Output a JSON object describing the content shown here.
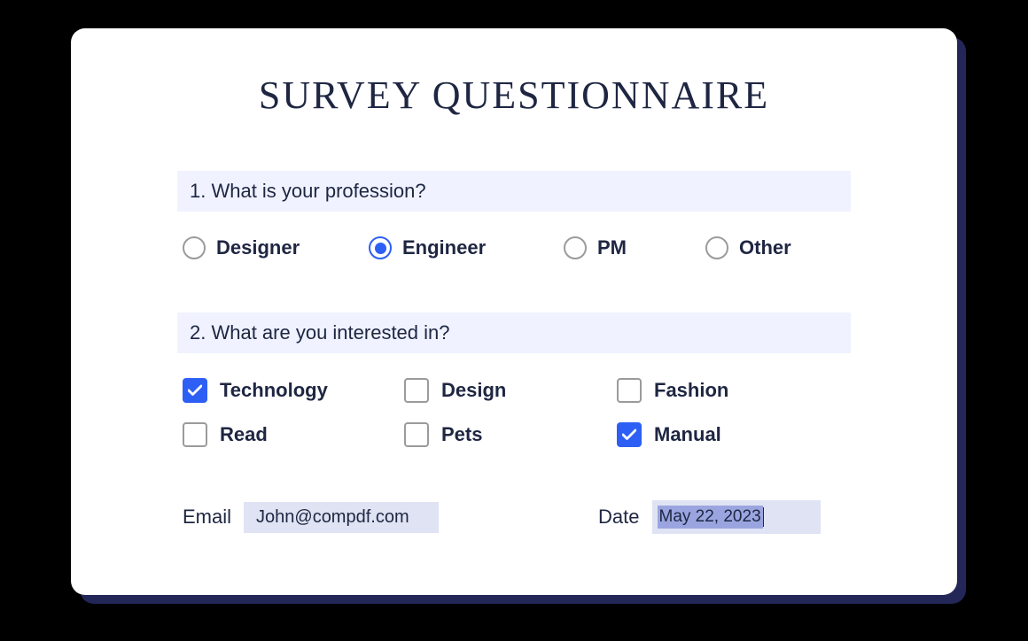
{
  "title": "SURVEY QUESTIONNAIRE",
  "question1": {
    "text": "1. What is your profession?",
    "options": [
      {
        "label": "Designer",
        "selected": false
      },
      {
        "label": "Engineer",
        "selected": true
      },
      {
        "label": "PM",
        "selected": false
      },
      {
        "label": "Other",
        "selected": false
      }
    ]
  },
  "question2": {
    "text": "2. What are you interested in?",
    "options": [
      {
        "label": "Technology",
        "checked": true
      },
      {
        "label": "Design",
        "checked": false
      },
      {
        "label": "Fashion",
        "checked": false
      },
      {
        "label": "Read",
        "checked": false
      },
      {
        "label": "Pets",
        "checked": false
      },
      {
        "label": "Manual",
        "checked": true
      }
    ]
  },
  "email": {
    "label": "Email",
    "value": "John@compdf.com"
  },
  "date": {
    "label": "Date",
    "value": "May 22, 2023"
  }
}
